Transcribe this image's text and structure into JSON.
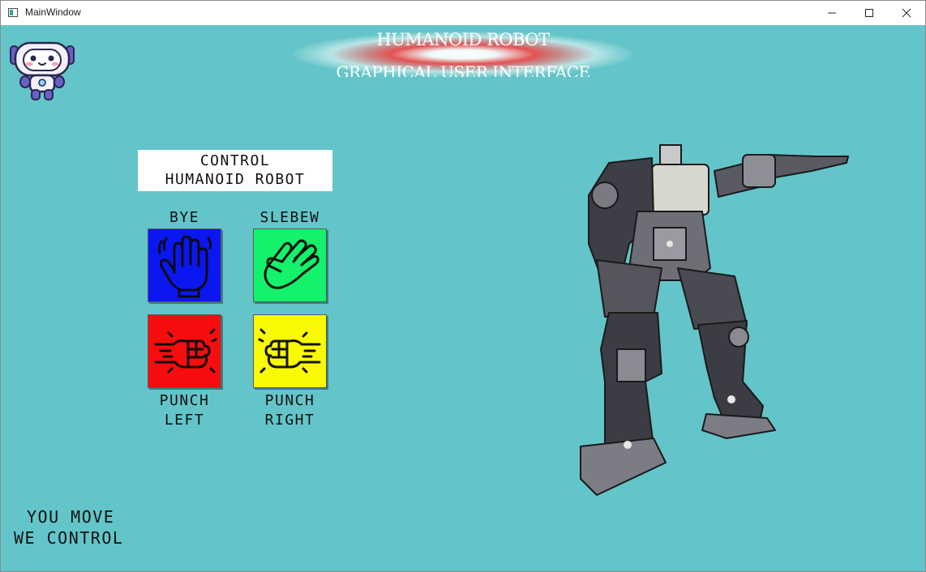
{
  "window": {
    "title": "MainWindow",
    "controls": [
      "minimize",
      "maximize",
      "close"
    ]
  },
  "header": {
    "title": "HUMANOID ROBOT",
    "subtitle": "GRAPHICAL USER INTERFACE"
  },
  "logo": {
    "icon": "robot-mascot-icon"
  },
  "control_panel": {
    "title_line1": "CONTROL",
    "title_line2": "HUMANOID ROBOT",
    "buttons": [
      {
        "label": "BYE",
        "icon": "waving-hand-icon",
        "color": "#0a17f0"
      },
      {
        "label": "SLEBEW",
        "icon": "shaka-hand-icon",
        "color": "#13f26a"
      },
      {
        "label_line1": "PUNCH",
        "label_line2": "LEFT",
        "icon": "punch-left-icon",
        "color": "#f70d0d"
      },
      {
        "label_line1": "PUNCH",
        "label_line2": "RIGHT",
        "icon": "punch-right-icon",
        "color": "#fafa05"
      }
    ]
  },
  "slogan": {
    "line1": "YOU MOVE",
    "line2": "WE CONTROL"
  },
  "colors": {
    "background": "#63c5c9"
  },
  "robot_image": {
    "icon": "humanoid-robot-photo"
  }
}
